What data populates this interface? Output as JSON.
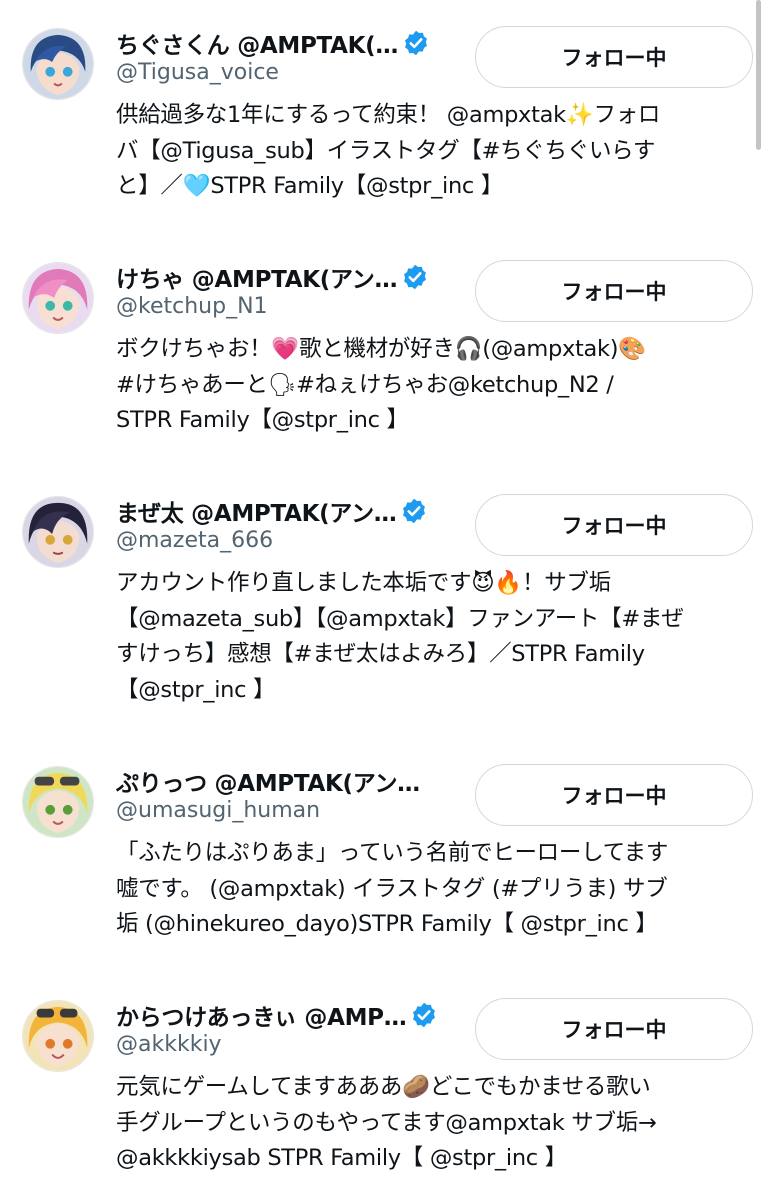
{
  "follow_label": "フォロー中",
  "accounts": [
    {
      "display_name": "ちぐさくん @AMPTAK(…",
      "handle": "@Tigusa_voice",
      "verified": true,
      "avatar_icon": "anime-character-avatar-blue-hair",
      "bio_lines": [
        "供給過多な1年にするって約束！ @ampxtak✨フォロ",
        "バ【@Tigusa_sub】イラストタグ【#ちぐちぐいらす",
        "と】／🩵STPR Family【@stpr_inc 】"
      ]
    },
    {
      "display_name": "けちゃ @AMPTAK(アン…",
      "handle": "@ketchup_N1",
      "verified": true,
      "avatar_icon": "anime-character-avatar-pink-hair",
      "bio_lines": [
        "ボクけちゃお！💗歌と機材が好き🎧(@ampxtak)🎨",
        "#けちゃあーと🗣#ねぇけちゃお@ketchup_N2 /",
        "STPR Family【@stpr_inc 】"
      ]
    },
    {
      "display_name": "まぜ太 @AMPTAK(アン…",
      "handle": "@mazeta_666",
      "verified": true,
      "avatar_icon": "anime-character-avatar-dark-hair",
      "bio_lines": [
        "アカウント作り直しました本垢です😈🔥！サブ垢",
        "【@mazeta_sub】【@ampxtak】ファンアート【#まぜ",
        "すけっち】感想【#まぜ太はよみろ】／STPR Family",
        "【@stpr_inc 】"
      ]
    },
    {
      "display_name": "ぷりっつ @AMPTAK(アン…",
      "handle": "@umasugi_human",
      "verified": false,
      "avatar_icon": "anime-character-avatar-blonde-goggles",
      "bio_lines": [
        "「ふたりはぷりあま」っていう名前でヒーローしてます",
        "嘘です。 (@ampxtak) イラストタグ (#プリうま) サブ",
        "垢 (@hinekureo_dayo)STPR Family【 @stpr_inc 】"
      ]
    },
    {
      "display_name": "からつけあっきぃ @AMP…",
      "handle": "@akkkkiy",
      "verified": true,
      "avatar_icon": "anime-character-avatar-yellow-goggles",
      "bio_lines": [
        "元気にゲームしてますあああ🥔どこでもかませる歌い",
        "手グループというのもやってます@ampxtak サブ垢→",
        "@akkkkiysab STPR Family【 @stpr_inc 】"
      ]
    }
  ],
  "colors": {
    "text": "#0f1419",
    "secondary": "#536471",
    "verified_blue": "#1d9bf0",
    "button_border": "#cfd9de"
  }
}
